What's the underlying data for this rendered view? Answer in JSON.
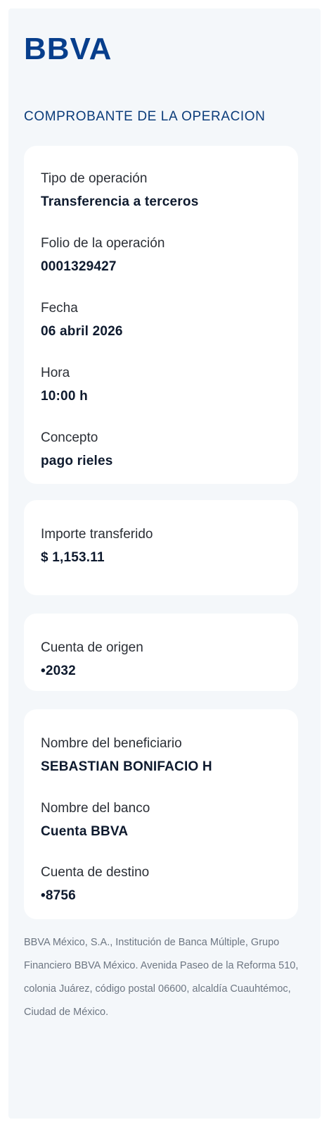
{
  "brand": {
    "logo_text": "BBVA",
    "color": "#073e8c"
  },
  "document": {
    "title": "COMPROBANTE DE LA OPERACION"
  },
  "operation": {
    "tipo_label": "Tipo de operación",
    "tipo_value": "Transferencia a terceros",
    "folio_label": "Folio de la operación",
    "folio_value": "0001329427",
    "fecha_label": "Fecha",
    "fecha_value": "06 abril 2026",
    "hora_label": "Hora",
    "hora_value": "10:00 h",
    "concepto_label": "Concepto",
    "concepto_value": "pago rieles"
  },
  "amount": {
    "label": "Importe transferido",
    "value": "$ 1,153.11"
  },
  "origin": {
    "label": "Cuenta de origen",
    "value": "•2032"
  },
  "beneficiary": {
    "name_label": "Nombre del beneficiario",
    "name_value": "SEBASTIAN BONIFACIO H",
    "bank_label": "Nombre del banco",
    "bank_value": "Cuenta BBVA",
    "dest_label": "Cuenta de destino",
    "dest_value": "•8756"
  },
  "footer": {
    "legal_text": "BBVA México, S.A., Institución de Banca Múltiple, Grupo Financiero BBVA México. Avenida Paseo de la Reforma 510, colonia Juárez, código postal 06600, alcaldía Cuauhtémoc, Ciudad de México."
  }
}
